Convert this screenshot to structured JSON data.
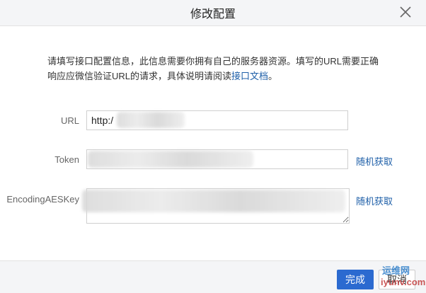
{
  "dialog": {
    "title": "修改配置",
    "description_text": "请填写接口配置信息，此信息需要你拥有自己的服务器资源。填写的URL需要正确响应应微信验证URL的请求，具体说明请阅读",
    "description_link": "接口文档",
    "description_end": "。"
  },
  "form": {
    "url_label": "URL",
    "url_value": "http:/",
    "token_label": "Token",
    "token_random": "随机获取",
    "aes_label": "EncodingAESKey",
    "aes_random": "随机获取"
  },
  "footer": {
    "ok_label": "完成",
    "cancel_label": "取消"
  },
  "watermark": {
    "top": "运维网",
    "bottom": "iyunv.com"
  },
  "icons": [
    "close-icon",
    "watermark-logo"
  ]
}
